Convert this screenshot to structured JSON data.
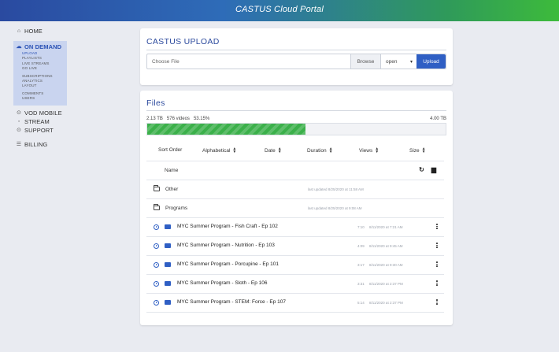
{
  "app": {
    "title": "CASTUS Cloud Portal"
  },
  "sidebar": {
    "home": "HOME",
    "on_demand": {
      "label": "ON DEMAND",
      "items": [
        "UPLOAD",
        "PLAYLISTS",
        "LIVE STREAMS",
        "GO LIVE",
        "SUBSCRIPTIONS",
        "ANALYTICS",
        "LAYOUT",
        "COMMENTS",
        "USERS"
      ],
      "active": "UPLOAD"
    },
    "vod_mobile": "VOD MOBILE",
    "stream": "STREAM",
    "support": "SUPPORT",
    "billing": "BILLING"
  },
  "upload": {
    "title": "CASTUS UPLOAD",
    "choose_file": "Choose File",
    "browse": "Browse",
    "select_value": "open",
    "upload_button": "Upload"
  },
  "files": {
    "title": "Files",
    "usage": {
      "used": "2.13 TB",
      "videos": "576 videos",
      "percent": "53.15%",
      "total": "4.00 TB",
      "fill_fraction": 0.5315
    },
    "sort": {
      "order_label": "Sort Order",
      "options": [
        "Alphabetical",
        "Date",
        "Duration",
        "Views",
        "Size"
      ]
    },
    "name_header": "Name",
    "folders": [
      {
        "name": "Other",
        "updated": "last updated 8/25/2020 at 11:58 AM"
      },
      {
        "name": "Programs",
        "updated": "last updated 8/25/2020 at 9:08 AM"
      }
    ],
    "videos": [
      {
        "name": "MYC Summer Program - Fish Craft - Ep 102",
        "duration": "7:10",
        "date": "8/11/2020 at 7:21 AM"
      },
      {
        "name": "MYC Summer Program - Nutrition - Ep 103",
        "duration": "4:09",
        "date": "8/11/2020 at 9:45 AM"
      },
      {
        "name": "MYC Summer Program - Porcupine - Ep 101",
        "duration": "3:17",
        "date": "8/11/2020 at 9:30 AM"
      },
      {
        "name": "MYC Summer Program - Sloth - Ep 106",
        "duration": "3:31",
        "date": "8/11/2020 at 2:37 PM"
      },
      {
        "name": "MYC Summer Program - STEM: Force - Ep 107",
        "duration": "5:14",
        "date": "8/11/2020 at 2:37 PM"
      }
    ]
  },
  "colors": {
    "accent": "#2f5fc4",
    "progress": "#3bb04a",
    "sidebar_active_bg": "#c9d4ef"
  }
}
